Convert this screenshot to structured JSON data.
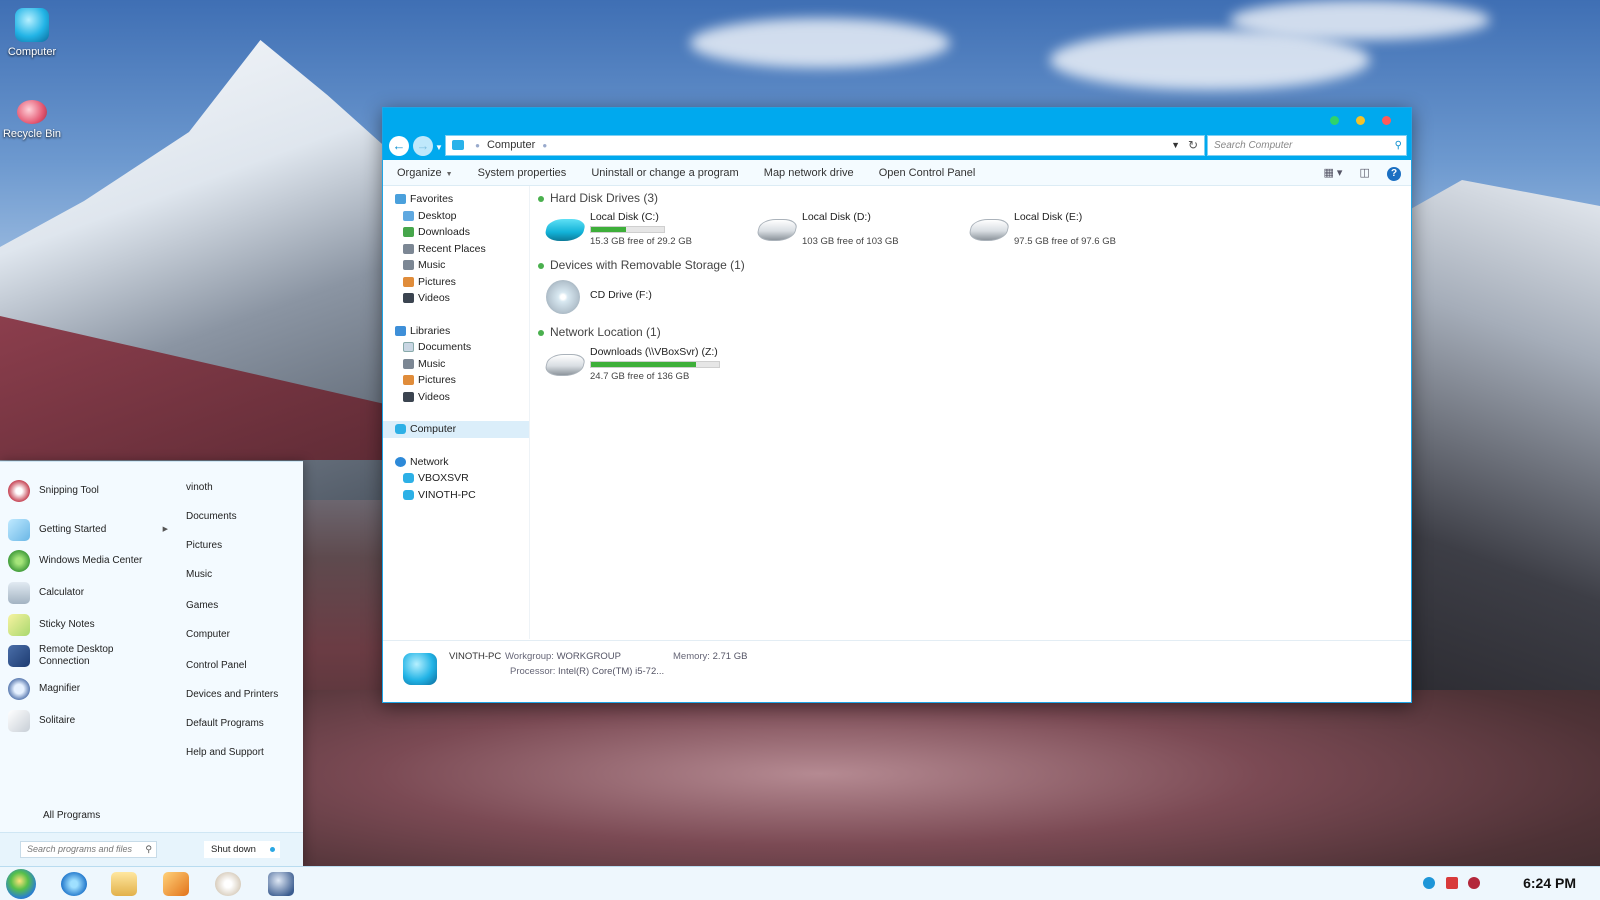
{
  "desktop": {
    "icons": [
      {
        "label": "Computer"
      },
      {
        "label": "Recycle Bin"
      }
    ]
  },
  "explorer": {
    "address": {
      "crumb": "Computer"
    },
    "search_placeholder": "Search Computer",
    "commands": [
      "Organize",
      "System properties",
      "Uninstall or change a program",
      "Map network drive",
      "Open Control Panel"
    ],
    "nav": {
      "favorites": "Favorites",
      "favorites_items": [
        "Desktop",
        "Downloads",
        "Recent Places",
        "Music",
        "Pictures",
        "Videos"
      ],
      "libraries": "Libraries",
      "libraries_items": [
        "Documents",
        "Music",
        "Pictures",
        "Videos"
      ],
      "computer": "Computer",
      "network": "Network",
      "network_items": [
        "VBOXSVR",
        "VINOTH-PC"
      ]
    },
    "groups": {
      "hard_disks": "Hard Disk Drives (3)",
      "removable": "Devices with Removable Storage (1)",
      "network": "Network Location (1)"
    },
    "drives": [
      {
        "name": "Local Disk (C:)",
        "size": "15.3 GB free of 29.2 GB",
        "used_fraction": 0.48,
        "has_bar": true
      },
      {
        "name": "Local Disk (D:)",
        "size": "103 GB free of 103 GB",
        "used_fraction": 0.0,
        "has_bar": false
      },
      {
        "name": "Local Disk (E:)",
        "size": "97.5 GB free of 97.6 GB",
        "used_fraction": 0.0,
        "has_bar": false
      }
    ],
    "removable": [
      {
        "name": "CD Drive (F:)"
      }
    ],
    "network_locations": [
      {
        "name": "Downloads (\\\\VBoxSvr) (Z:)",
        "size": "24.7 GB free of 136 GB",
        "used_fraction": 0.82,
        "has_bar": true
      }
    ],
    "details": {
      "pc_name": "VINOTH-PC",
      "workgroup_label": "Workgroup:",
      "workgroup_value": "WORKGROUP",
      "memory_label": "Memory:",
      "memory_value": "2.71 GB",
      "processor_label": "Processor:",
      "processor_value": "Intel(R) Core(TM) i5-72..."
    }
  },
  "start_menu": {
    "programs": [
      {
        "label": "Snipping Tool",
        "icon": "scissors-icon"
      },
      {
        "label": "Getting Started",
        "icon": "getting-started-icon",
        "has_submenu": true
      },
      {
        "label": "Windows Media Center",
        "icon": "media-center-icon"
      },
      {
        "label": "Calculator",
        "icon": "calculator-icon"
      },
      {
        "label": "Sticky Notes",
        "icon": "sticky-notes-icon"
      },
      {
        "label": "Remote Desktop\nConnection",
        "icon": "remote-desktop-icon"
      },
      {
        "label": "Magnifier",
        "icon": "magnifier-icon"
      },
      {
        "label": "Solitaire",
        "icon": "solitaire-icon"
      }
    ],
    "all_programs": "All Programs",
    "links": [
      "vinoth",
      "Documents",
      "Pictures",
      "Music",
      "Games",
      "Computer",
      "Control Panel",
      "Devices and Printers",
      "Default Programs",
      "Help and Support"
    ],
    "search_placeholder": "Search programs and files",
    "shutdown": "Shut down"
  },
  "taskbar": {
    "clock": "6:24 PM",
    "pinned": [
      "internet-explorer-icon",
      "folder-icon",
      "media-player-icon",
      "paint-icon",
      "computer-app-icon"
    ]
  }
}
